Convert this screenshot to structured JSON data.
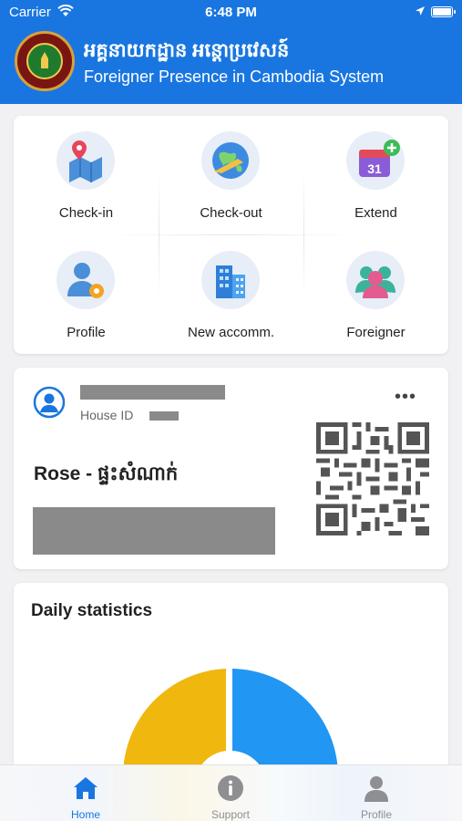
{
  "status_bar": {
    "carrier": "Carrier",
    "time": "6:48 PM"
  },
  "header": {
    "title_khmer": "អគ្គនាយកដ្ឋាន អន្តោប្រវេសន៍",
    "title_english": "Foreigner Presence in Cambodia System",
    "brand_color": "#1976e0"
  },
  "menu": {
    "items": [
      {
        "label": "Check-in",
        "icon": "check-in-map-icon"
      },
      {
        "label": "Check-out",
        "icon": "check-out-globe-icon"
      },
      {
        "label": "Extend",
        "icon": "extend-calendar-icon"
      },
      {
        "label": "Profile",
        "icon": "profile-settings-icon"
      },
      {
        "label": "New accomm.",
        "icon": "new-accommodation-building-icon"
      },
      {
        "label": "Foreigner",
        "icon": "foreigner-group-icon"
      }
    ]
  },
  "house": {
    "id_label": "House ID",
    "name": "Rose - ផ្ទះសំណាក់",
    "more_label": "•••"
  },
  "stats": {
    "title": "Daily statistics",
    "colors": [
      "#f0b70e",
      "#2196f3"
    ]
  },
  "tabs": [
    {
      "label": "Home",
      "icon": "home-icon",
      "color": "#1976e0"
    },
    {
      "label": "Support",
      "icon": "info-icon",
      "color": "#8e8e93"
    },
    {
      "label": "Profile",
      "icon": "person-icon",
      "color": "#8e8e93"
    }
  ]
}
